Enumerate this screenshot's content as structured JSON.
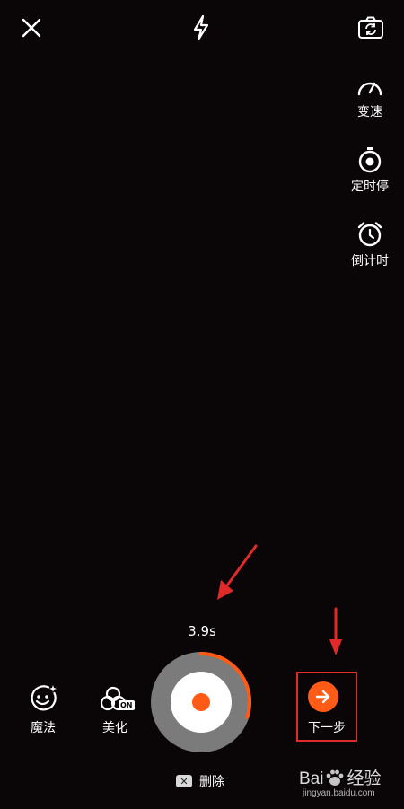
{
  "header": {
    "close_icon": "close-icon",
    "flash_icon": "flash-icon",
    "flip_camera_icon": "flip-camera-icon"
  },
  "side_menu": [
    {
      "label": "变速",
      "icon": "speed-icon"
    },
    {
      "label": "定时停",
      "icon": "timed-stop-icon"
    },
    {
      "label": "倒计时",
      "icon": "countdown-icon"
    }
  ],
  "recording": {
    "elapsed": "3.9s",
    "progress_fraction": 0.3
  },
  "bottom_bar": {
    "magic_label": "魔法",
    "beautify_label": "美化",
    "beautify_badge": "ON",
    "delete_label": "删除",
    "next_label": "下一步"
  },
  "watermark": {
    "logo_text_left": "Bai",
    "logo_text_right": "经验",
    "url": "jingyan.baidu.com"
  },
  "colors": {
    "accent": "#ff5a16",
    "highlight_box": "#e02a2a",
    "annotation_arrow": "#e02a2a"
  }
}
